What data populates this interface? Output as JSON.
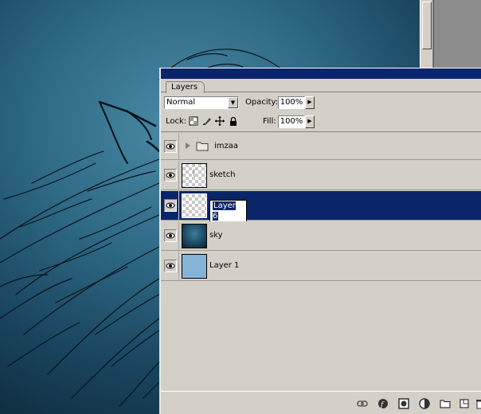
{
  "palette": {
    "tab_label": "Layers",
    "blend_mode": "Normal",
    "opacity_label": "Opacity:",
    "opacity_value": "100%",
    "lock_label": "Lock:",
    "fill_label": "Fill:",
    "fill_value": "100%"
  },
  "layers": [
    {
      "name": "imzaa",
      "type": "group",
      "visible": true,
      "selected": false
    },
    {
      "name": "sketch",
      "type": "layer",
      "thumb": "checker",
      "visible": true,
      "selected": false
    },
    {
      "name": "Layer 6",
      "type": "layer",
      "thumb": "checker",
      "visible": true,
      "selected": true,
      "editing": true
    },
    {
      "name": "sky",
      "type": "layer",
      "thumb": "sky",
      "visible": true,
      "selected": false
    },
    {
      "name": "Layer 1",
      "type": "layer",
      "thumb": "blue",
      "visible": true,
      "selected": false
    }
  ],
  "bottom_icons": [
    "link-icon",
    "layer-style-icon",
    "layer-mask-icon",
    "adjustment-layer-icon",
    "new-group-icon",
    "new-layer-icon",
    "trash-icon"
  ],
  "colors": {
    "palette_bg": "#d4d0c8",
    "selection": "#0a246a",
    "canvas_light": "#4b8aa6",
    "canvas_dark": "#0b2433"
  }
}
